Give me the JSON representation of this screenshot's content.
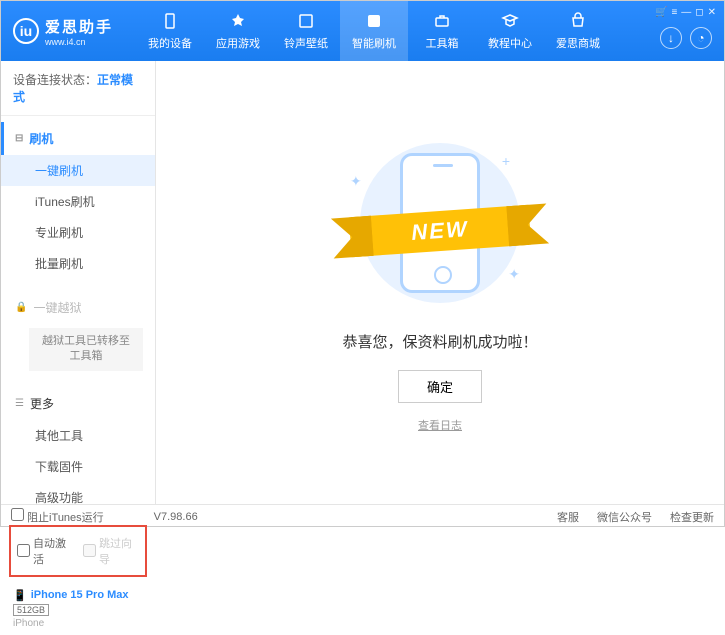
{
  "logo": {
    "icon_text": "iu",
    "title": "爱思助手",
    "subtitle": "www.i4.cn"
  },
  "nav": [
    {
      "label": "我的设备"
    },
    {
      "label": "应用游戏"
    },
    {
      "label": "铃声壁纸"
    },
    {
      "label": "智能刷机"
    },
    {
      "label": "工具箱"
    },
    {
      "label": "教程中心"
    },
    {
      "label": "爱思商城"
    }
  ],
  "titlebar_icons": [
    "cart",
    "menu",
    "min",
    "max",
    "close"
  ],
  "sidebar": {
    "status_label": "设备连接状态：",
    "status_mode": "正常模式",
    "section_flash": "刷机",
    "items_flash": [
      "一键刷机",
      "iTunes刷机",
      "专业刷机",
      "批量刷机"
    ],
    "section_jailbreak": "一键越狱",
    "jailbreak_note": "越狱工具已转移至工具箱",
    "section_more": "更多",
    "items_more": [
      "其他工具",
      "下载固件",
      "高级功能"
    ],
    "checkbox1": "自动激活",
    "checkbox2": "跳过向导",
    "device_name": "iPhone 15 Pro Max",
    "device_storage": "512GB",
    "device_type": "iPhone"
  },
  "main": {
    "ribbon": "NEW",
    "success_text": "恭喜您，保资料刷机成功啦！",
    "confirm": "确定",
    "view_log": "查看日志"
  },
  "footer": {
    "block_itunes": "阻止iTunes运行",
    "version": "V7.98.66",
    "links": [
      "客服",
      "微信公众号",
      "检查更新"
    ]
  }
}
